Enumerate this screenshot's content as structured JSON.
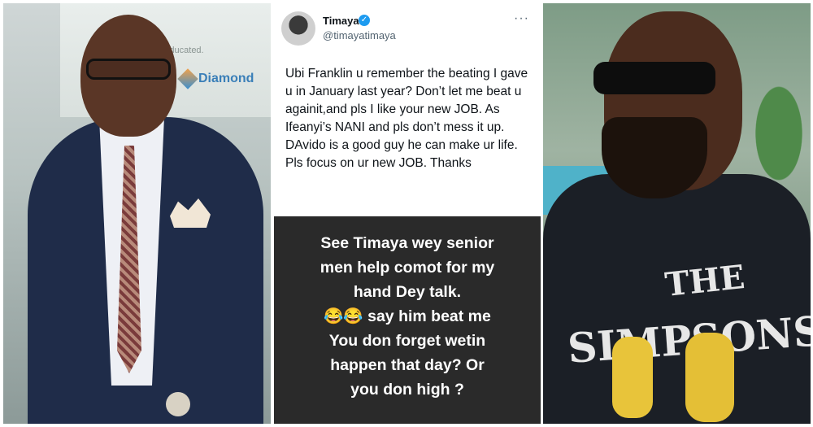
{
  "left_photo": {
    "wall_text": "Gyn. Get Educated.",
    "brand": "Diamond"
  },
  "tweet": {
    "name": "Timaya",
    "handle": "@timayatimaya",
    "verified_mark": "✓",
    "more": "···",
    "text": "Ubi Franklin u remember the beating I gave u in January last year?  Don’t let me beat u againit,and pls I like your new JOB. As Ifeanyi’s NANI and pls don’t mess it up. DAvido is a good guy he can make ur life. Pls focus on ur new JOB. Thanks"
  },
  "story": {
    "line1": "See Timaya wey senior",
    "line2": "men help comot for my",
    "line3": "hand Dey talk.",
    "line4": "😂😂 say him beat me",
    "line5": "You don forget wetin",
    "line6": "happen that day? Or",
    "line7": "you don high ?"
  },
  "right_photo": {
    "print_line1": "THE",
    "print_line2": "SIMPSONS"
  }
}
